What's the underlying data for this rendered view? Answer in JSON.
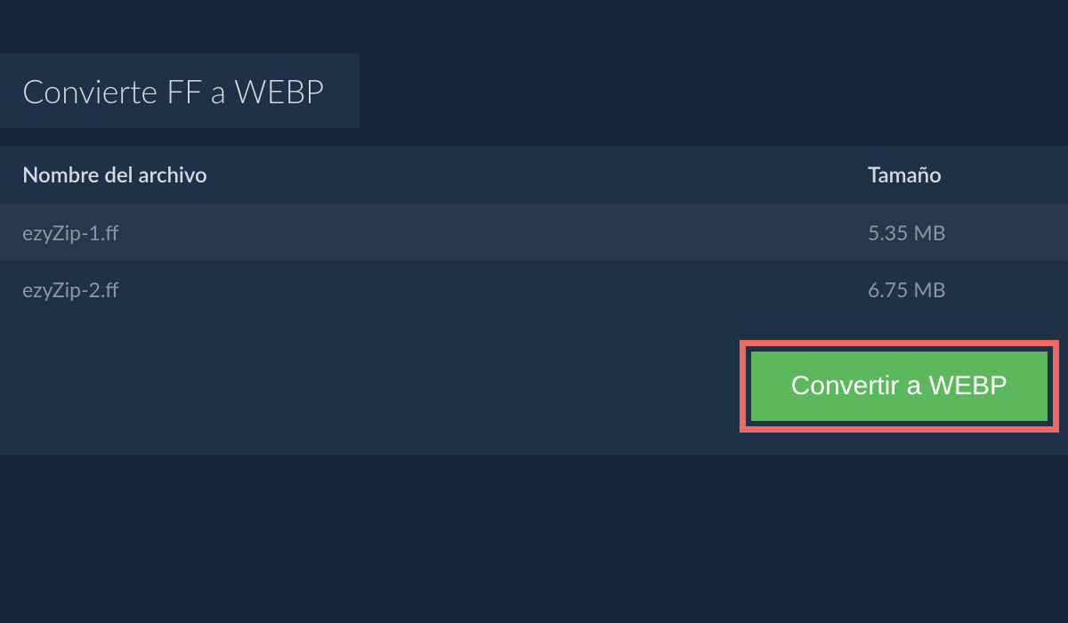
{
  "tab": {
    "title": "Convierte FF a WEBP"
  },
  "table": {
    "headers": {
      "filename": "Nombre del archivo",
      "size": "Tamaño"
    },
    "rows": [
      {
        "filename": "ezyZip-1.ff",
        "size": "5.35 MB"
      },
      {
        "filename": "ezyZip-2.ff",
        "size": "6.75 MB"
      }
    ]
  },
  "actions": {
    "convert_label": "Convertir a WEBP"
  }
}
